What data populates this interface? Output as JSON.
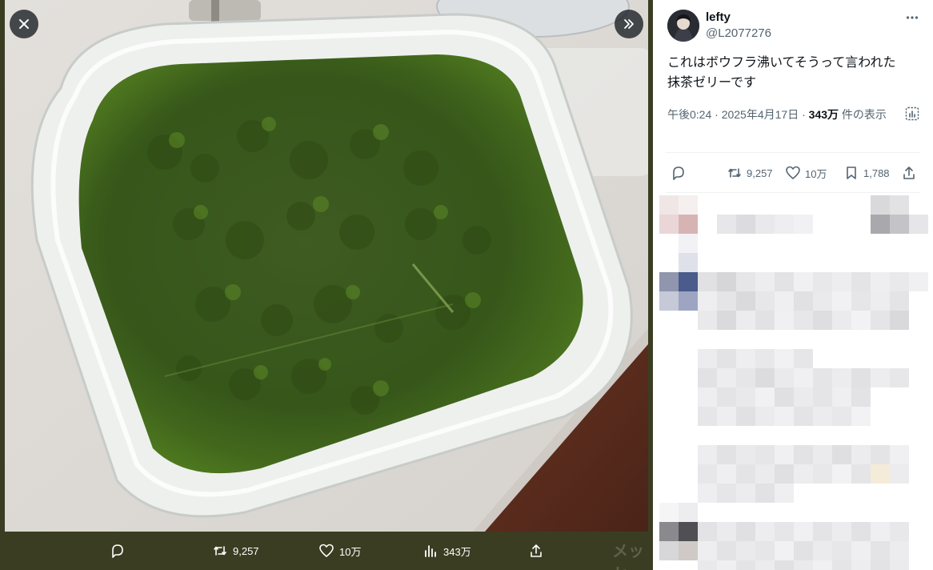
{
  "viewer": {
    "close_icon": "close-icon",
    "expand_icon": "chevron-double-right-icon",
    "actions": [
      {
        "name": "reply",
        "icon": "reply-icon",
        "label": ""
      },
      {
        "name": "retweet",
        "icon": "retweet-icon",
        "label": "9,257"
      },
      {
        "name": "like",
        "icon": "heart-icon",
        "label": "10万"
      },
      {
        "name": "views",
        "icon": "bar-chart-icon",
        "label": "343万"
      },
      {
        "name": "share",
        "icon": "share-icon",
        "label": ""
      }
    ],
    "faint_text": "メッセ"
  },
  "tweet": {
    "author_name": "lefty",
    "author_handle": "@L2077276",
    "text_line1": "これはボウフラ沸いてそうって言われた",
    "text_line2": "抹茶ゼリーです",
    "time": "午後0:24",
    "date": "2025年4月17日",
    "views_count": "343万",
    "views_label": "件の表示",
    "dot": "·"
  },
  "panel_actions": [
    {
      "name": "reply",
      "icon": "reply-icon",
      "label": ""
    },
    {
      "name": "retweet",
      "icon": "retweet-icon",
      "label": "9,257"
    },
    {
      "name": "like",
      "icon": "heart-icon",
      "label": "10万"
    },
    {
      "name": "bookmark",
      "icon": "bookmark-icon",
      "label": "1,788"
    },
    {
      "name": "share",
      "icon": "share-icon",
      "label": ""
    }
  ],
  "colors": {
    "viewer_bg": "#3b3d22",
    "jelly": "#3d5e1a",
    "text_primary": "#0f1419",
    "text_secondary": "#536471"
  }
}
